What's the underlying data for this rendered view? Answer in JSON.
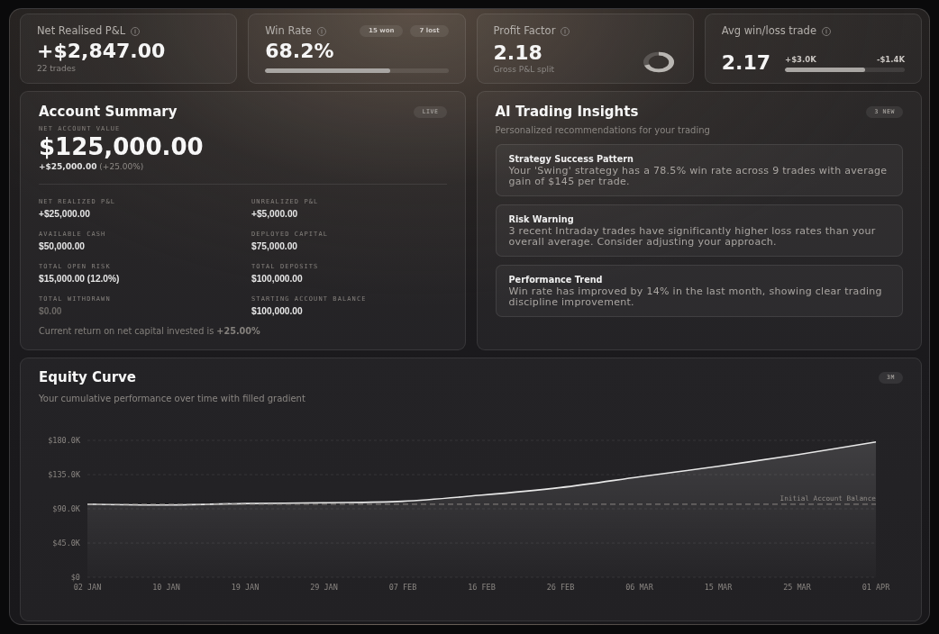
{
  "stat_cards": [
    {
      "kind": "value",
      "label": "Net Realised P&L",
      "value": "+$2,847.00",
      "caption": "22 trades"
    },
    {
      "kind": "progress",
      "label": "Win Rate",
      "badges": [
        "15 won",
        "7 lost"
      ],
      "value": "68.2%",
      "level": 0.682
    },
    {
      "kind": "ring",
      "label": "Profit Factor",
      "value": "2.18",
      "caption": "Gross P&L split",
      "level": 0.69
    },
    {
      "kind": "split",
      "label": "Avg win/loss trade",
      "value": "2.17",
      "win": "+$3.0K",
      "loss": "-$1.4K",
      "level": 0.67
    }
  ],
  "account_summary": {
    "title": "Account Summary",
    "badge": "LIVE",
    "value_label": "NET ACCOUNT VALUE",
    "value": "$125,000.00",
    "change": "+$25,000.00",
    "change_percent": "(+25.00%)",
    "metrics": [
      {
        "label": "NET REALIZED P&L",
        "value": "+$25,000.00",
        "dimmed": false
      },
      {
        "label": "UNREALIZED P&L",
        "value": "+$5,000.00",
        "dimmed": false
      },
      {
        "label": "AVAILABLE CASH",
        "value": "$50,000.00",
        "dimmed": false
      },
      {
        "label": "DEPLOYED CAPITAL",
        "value": "$75,000.00",
        "dimmed": false
      },
      {
        "label": "TOTAL OPEN RISK",
        "value": "$15,000.00 (12.0%)",
        "dimmed": false
      },
      {
        "label": "TOTAL DEPOSITS",
        "value": "$100,000.00",
        "dimmed": false
      },
      {
        "label": "TOTAL WITHDRAWN",
        "value": "$0.00",
        "dimmed": true
      },
      {
        "label": "STARTING ACCOUNT BALANCE",
        "value": "$100,000.00",
        "dimmed": false
      }
    ],
    "note": "Current return on net capital invested is **+25.00%**"
  },
  "ai_insights": {
    "title": "AI Trading Insights",
    "badge": "3 NEW",
    "subtitle": "Personalized recommendations for your trading",
    "insights": [
      {
        "title": "Strategy Success Pattern",
        "text": "Your 'Swing' strategy has a 78.5% win rate across 9 trades with average gain of $145 per trade."
      },
      {
        "title": "Risk Warning",
        "text": "3 recent Intraday trades have significantly higher loss rates than your overall average. Consider adjusting your approach."
      },
      {
        "title": "Performance Trend",
        "text": "Win rate has improved by 14% in the last month, showing clear trading discipline improvement."
      }
    ]
  },
  "equity_curve": {
    "title": "Equity Curve",
    "subtitle": "Your cumulative performance over time with filled gradient",
    "badge": "3M",
    "chart_data": {
      "type": "area",
      "categories": [
        "02 JAN",
        "10 JAN",
        "19 JAN",
        "29 JAN",
        "07 FEB",
        "16 FEB",
        "26 FEB",
        "06 MAR",
        "15 MAR",
        "25 MAR",
        "01 APR"
      ],
      "values": [
        96000,
        95000,
        97000,
        98000,
        100000,
        108000,
        118000,
        132000,
        146000,
        161000,
        178000
      ],
      "ylim": [
        0,
        180000
      ],
      "yticks": [
        {
          "value": 180000,
          "label": "$180.0K"
        },
        {
          "value": 135000,
          "label": "$135.0K"
        },
        {
          "value": 90000,
          "label": "$90.0K"
        },
        {
          "value": 45000,
          "label": "$45.0K"
        },
        {
          "value": 0,
          "label": "$0"
        }
      ],
      "grid": true,
      "ref_lines": [
        {
          "axis": "y",
          "value": 96000,
          "label": "Initial Account Balance"
        }
      ]
    }
  }
}
